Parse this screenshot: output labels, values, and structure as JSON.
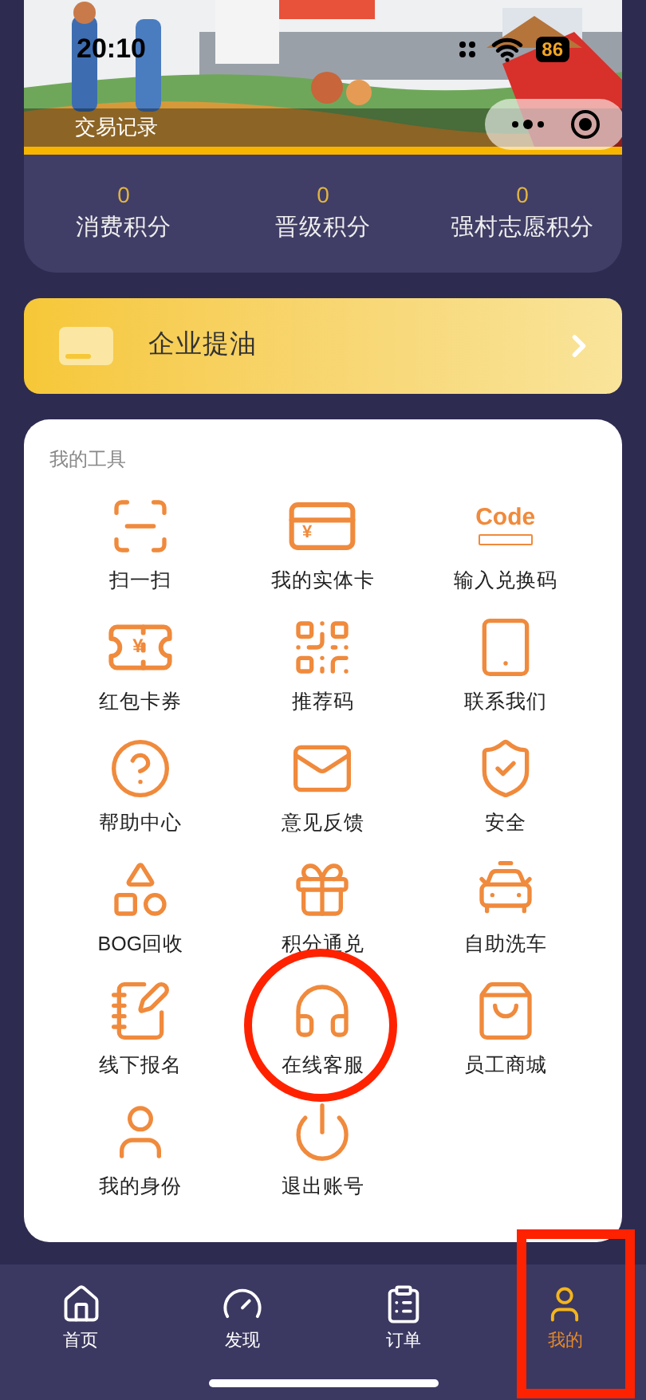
{
  "status_bar": {
    "time": "20:10",
    "battery": "86"
  },
  "banner": {
    "link": "交易记录"
  },
  "points": [
    {
      "value": "0",
      "label": "消费积分"
    },
    {
      "value": "0",
      "label": "晋级积分"
    },
    {
      "value": "0",
      "label": "强村志愿积分"
    }
  ],
  "enterprise_card": {
    "title": "企业提油"
  },
  "tools": {
    "title": "我的工具",
    "items": [
      {
        "label": "扫一扫",
        "highlighted": false
      },
      {
        "label": "我的实体卡",
        "highlighted": false,
        "icon_text": "¥"
      },
      {
        "label": "输入兑换码",
        "highlighted": false,
        "icon_text": "Code"
      },
      {
        "label": "红包卡券",
        "highlighted": false,
        "icon_text": "¥"
      },
      {
        "label": "推荐码",
        "highlighted": false
      },
      {
        "label": "联系我们",
        "highlighted": false
      },
      {
        "label": "帮助中心",
        "highlighted": false
      },
      {
        "label": "意见反馈",
        "highlighted": false
      },
      {
        "label": "安全",
        "highlighted": false
      },
      {
        "label": "BOG回收",
        "highlighted": false
      },
      {
        "label": "积分通兑",
        "highlighted": false
      },
      {
        "label": "自助洗车",
        "highlighted": false
      },
      {
        "label": "线下报名",
        "highlighted": false
      },
      {
        "label": "在线客服",
        "highlighted": true
      },
      {
        "label": "员工商城",
        "highlighted": false
      },
      {
        "label": "我的身份",
        "highlighted": false
      },
      {
        "label": "退出账号",
        "highlighted": false
      }
    ]
  },
  "tab_bar": [
    {
      "label": "首页",
      "selected": false,
      "highlighted": false
    },
    {
      "label": "发现",
      "selected": false,
      "highlighted": false
    },
    {
      "label": "订单",
      "selected": false,
      "highlighted": false
    },
    {
      "label": "我的",
      "selected": true,
      "highlighted": true
    }
  ]
}
